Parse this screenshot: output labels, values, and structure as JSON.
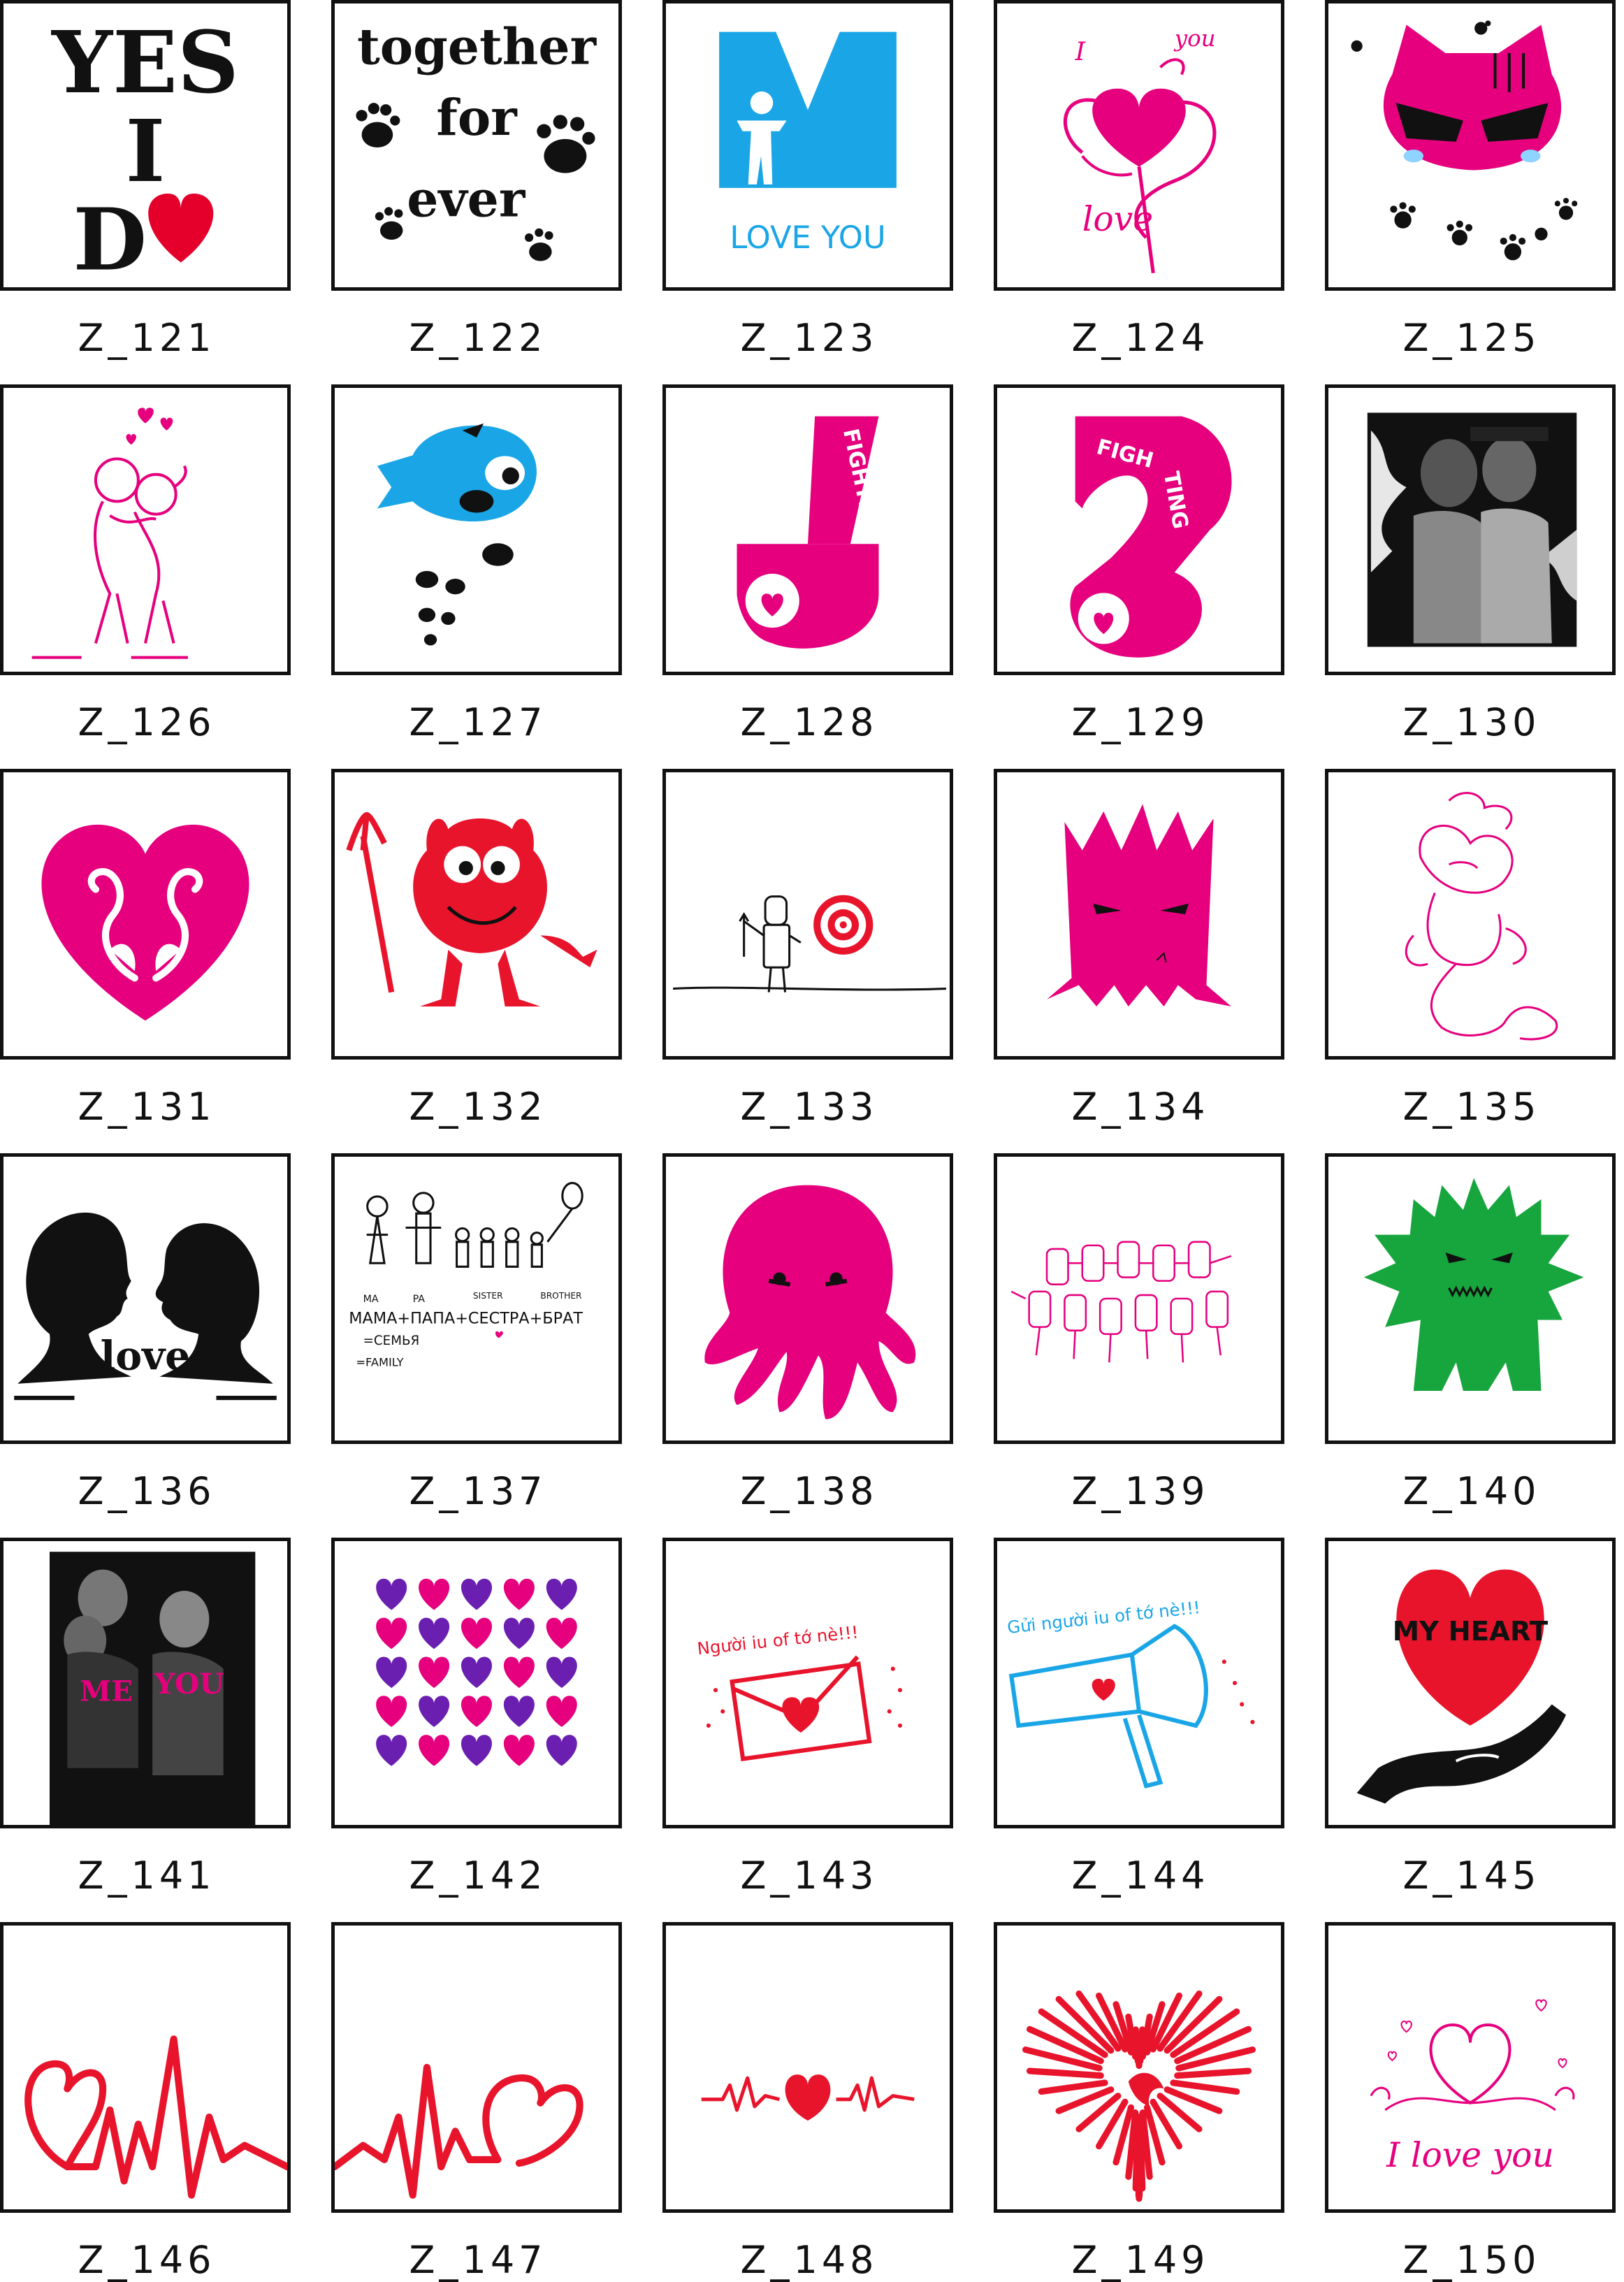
{
  "items": [
    {
      "code": "Z_121",
      "art": "yes-i-do",
      "texts": [
        "YES",
        "I",
        "D"
      ],
      "color": "#e4002b"
    },
    {
      "code": "Z_122",
      "art": "together-forever",
      "texts": [
        "together",
        "for",
        "ever"
      ],
      "color": "#111111"
    },
    {
      "code": "Z_123",
      "art": "m-love-you",
      "texts": [
        "M",
        "LOVE  YOU"
      ],
      "color": "#1aa6e6"
    },
    {
      "code": "Z_124",
      "art": "i-you-love-heart",
      "texts": [
        "I",
        "you",
        "love"
      ],
      "color": "#e6007e"
    },
    {
      "code": "Z_125",
      "art": "cat-paws",
      "texts": [],
      "color": "#e6007e"
    },
    {
      "code": "Z_126",
      "art": "hugging-couple",
      "texts": [],
      "color": "#e6007e"
    },
    {
      "code": "Z_127",
      "art": "blue-fish",
      "texts": [],
      "color": "#1aa6e6"
    },
    {
      "code": "Z_128",
      "art": "fighting-1",
      "texts": [
        "FIGHTING"
      ],
      "color": "#e6007e"
    },
    {
      "code": "Z_129",
      "art": "fighting-2",
      "texts": [
        "FIGH",
        "TING"
      ],
      "color": "#e6007e"
    },
    {
      "code": "Z_130",
      "art": "couple-photo",
      "texts": [],
      "color": "#111111"
    },
    {
      "code": "Z_131",
      "art": "flamingo-heart",
      "texts": [],
      "color": "#e6007e"
    },
    {
      "code": "Z_132",
      "art": "red-devil",
      "texts": [],
      "color": "#e8142c"
    },
    {
      "code": "Z_133",
      "art": "man-target",
      "texts": [],
      "color": "#e8142c"
    },
    {
      "code": "Z_134",
      "art": "pink-monster",
      "texts": [],
      "color": "#e6007e"
    },
    {
      "code": "Z_135",
      "art": "pink-sketch",
      "texts": [],
      "color": "#e6007e"
    },
    {
      "code": "Z_136",
      "art": "silhouette-love",
      "texts": [
        "love"
      ],
      "color": "#111111"
    },
    {
      "code": "Z_137",
      "art": "family-drawing",
      "texts": [
        "MA",
        "PA",
        "SISTER",
        "BROTHER",
        "МАМА+ПАПА+СЕСТРА+БРАТ",
        "=СЕМЬЯ",
        "=FAMILY"
      ],
      "color": "#111111"
    },
    {
      "code": "Z_138",
      "art": "pink-octopus",
      "texts": [],
      "color": "#e6007e"
    },
    {
      "code": "Z_139",
      "art": "sketch-crowd",
      "texts": [],
      "color": "#e6007e"
    },
    {
      "code": "Z_140",
      "art": "green-monster",
      "texts": [],
      "color": "#17a53e"
    },
    {
      "code": "Z_141",
      "art": "me-you-photo",
      "texts": [
        "ME",
        "YOU"
      ],
      "color": "#e6007e"
    },
    {
      "code": "Z_142",
      "art": "hearts-grid",
      "texts": [],
      "color": "#e6007e"
    },
    {
      "code": "Z_143",
      "art": "love-letter",
      "texts": [
        "Người iu of tớ nè!!!"
      ],
      "color": "#e8142c"
    },
    {
      "code": "Z_144",
      "art": "megaphone",
      "texts": [
        "Gửi người iu of tớ nè!!!"
      ],
      "color": "#1aa6e6"
    },
    {
      "code": "Z_145",
      "art": "my-heart-hand",
      "texts": [
        "MY HEART"
      ],
      "color": "#e8142c"
    },
    {
      "code": "Z_146",
      "art": "heartbeat-left",
      "texts": [],
      "color": "#e8142c"
    },
    {
      "code": "Z_147",
      "art": "heartbeat-right",
      "texts": [],
      "color": "#e8142c"
    },
    {
      "code": "Z_148",
      "art": "heartbeat-center",
      "texts": [],
      "color": "#e8142c"
    },
    {
      "code": "Z_149",
      "art": "sunburst-heart",
      "texts": [],
      "color": "#e8142c"
    },
    {
      "code": "Z_150",
      "art": "i-love-you-script",
      "texts": [
        "I love you"
      ],
      "color": "#e6007e"
    }
  ]
}
